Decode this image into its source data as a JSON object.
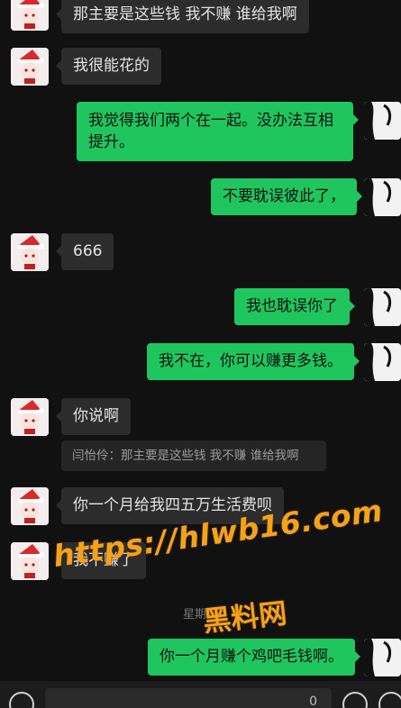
{
  "messages": [
    {
      "side": "in",
      "text": "那主要是这些钱 我不赚 谁给我啊"
    },
    {
      "side": "in",
      "text": "我很能花的"
    },
    {
      "side": "out",
      "lines": [
        "我觉得我们两个在一起。没办法互相",
        "提升。"
      ]
    },
    {
      "side": "out",
      "text": "不要耽误彼此了，"
    },
    {
      "side": "in",
      "text": "666"
    },
    {
      "side": "out",
      "text": "我也耽误你了"
    },
    {
      "side": "out",
      "text": "我不在，你可以赚更多钱。"
    },
    {
      "side": "in",
      "text": "你说啊"
    },
    {
      "side": "in",
      "text": "你一个月给我四五万生活费呗"
    },
    {
      "side": "in",
      "text": "我不赚了"
    },
    {
      "side": "out",
      "text": "你一个月赚个鸡吧毛钱啊。"
    }
  ],
  "quote": {
    "text": "闫怡伶：那主要是这些钱 我不赚 谁给我啊"
  },
  "time_divider": "星期日",
  "watermark": {
    "url": "https://hlwb16.com",
    "cn": "黑料网"
  },
  "input_bar": {
    "value": "0"
  },
  "colors": {
    "background": "#111111",
    "out_bubble": "#1fc65e",
    "in_bubble": "#2c2c2c",
    "watermark": "#f3a21a"
  }
}
